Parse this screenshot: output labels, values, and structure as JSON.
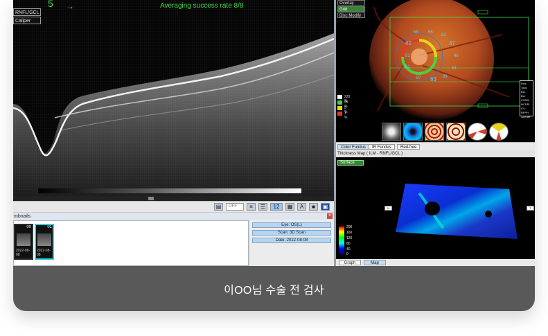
{
  "oct": {
    "frame_number": "5",
    "arrow": "→",
    "status": "Averaging success rate  8/8",
    "labels": [
      "RNFL/GCL",
      "Caliper"
    ]
  },
  "toolbar": {
    "off_label": "OFF",
    "zoom_value": "12",
    "text_tool": "A"
  },
  "thumbnails": {
    "panel_title": "mbnails",
    "close": "×",
    "items": [
      {
        "number": "00",
        "date": "2022-08-08",
        "selected": false
      },
      {
        "number": "01",
        "date": "2022-08-08",
        "selected": true
      }
    ]
  },
  "scan_info": {
    "eye": "Eye: OS(L)",
    "scan": "Scan: 3D Scan",
    "date": "Date: 2022-08-08"
  },
  "fundus": {
    "menu": [
      {
        "label": "Overlay",
        "active": false
      },
      {
        "label": "Grid",
        "active": true
      },
      {
        "label": "Disc Modify",
        "active": false
      }
    ],
    "sector_values": [
      "58",
      "55",
      "82",
      "42",
      "47",
      "81",
      "46",
      "61",
      "54",
      "87",
      "83",
      "89"
    ],
    "legend": [
      {
        "text": "220 %",
        "color": "#ffffff"
      },
      {
        "text": "95 %",
        "color": "#3fd24a"
      },
      {
        "text": "5 %",
        "color": "#e8d21a"
      },
      {
        "text": "1 %",
        "color": "#d63a2a"
      }
    ],
    "info_box": [
      "Disc Topo",
      "RA:",
      "DA:",
      "VCDR:",
      "HCDR:",
      "CV:",
      "RFPH",
      "120 um"
    ]
  },
  "fundus_tabs": {
    "tabs": [
      "Color Fundus",
      "IR Fundus",
      "Red-free"
    ],
    "active": "Color Fundus"
  },
  "thickness": {
    "header": "Thickness Map  ( ILM - RNFL/GCL )",
    "surface_btn": "Surface",
    "scale_labels": [
      "200",
      "160",
      "120",
      "80",
      "40",
      "0"
    ],
    "corner_left": "N",
    "corner_right": "T"
  },
  "bottom_tabs": {
    "tabs": [
      "Graph",
      "Map"
    ],
    "active": "Map"
  },
  "caption": "이OO님 수술 전 검사",
  "colors": {
    "accent_green": "#3fdc4b",
    "caption_bg": "#595959",
    "selected_thumb": "#22d6e6"
  }
}
